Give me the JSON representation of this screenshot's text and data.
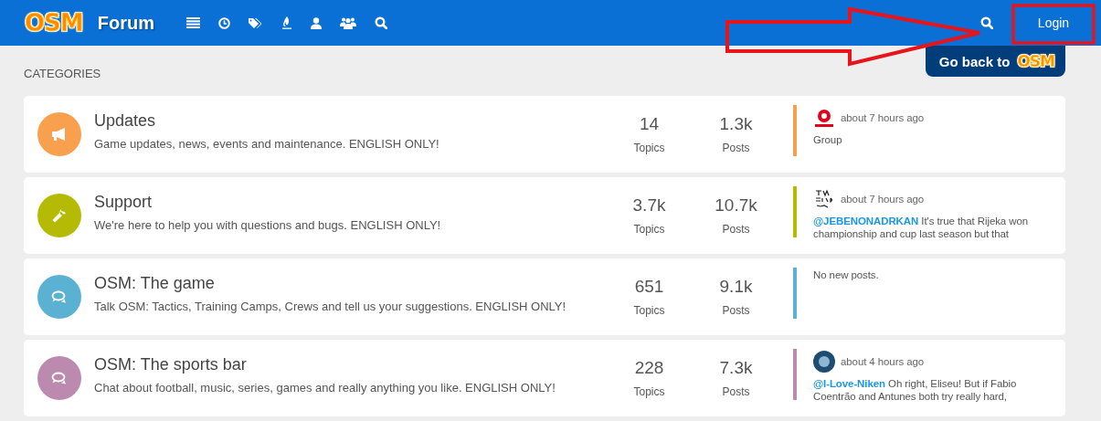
{
  "header": {
    "logo": "OSM",
    "title": "Forum",
    "nav_icons": [
      {
        "kind": "list"
      },
      {
        "kind": "clock"
      },
      {
        "kind": "tags"
      },
      {
        "kind": "flame"
      },
      {
        "kind": "user"
      },
      {
        "kind": "users"
      },
      {
        "kind": "search"
      }
    ],
    "login": "Login",
    "back_link": {
      "text": "Go back to",
      "logo": "OSM"
    }
  },
  "section_title": "CATEGORIES",
  "categories": [
    {
      "title": "Updates",
      "description": "Game updates, news, events and maintenance. ENGLISH ONLY!",
      "kind": "megaphone",
      "color": "#f9a04e",
      "topics": "14",
      "topics_label": "Topics",
      "posts": "1.3k",
      "posts_label": "Posts",
      "last_post": {
        "kind": "post",
        "time": "about 7 hours ago",
        "text": "Group"
      }
    },
    {
      "title": "Support",
      "description": "We're here to help you with questions and bugs. ENGLISH ONLY!",
      "kind": "wrench",
      "color": "#b5bb04",
      "topics": "3.7k",
      "topics_label": "Topics",
      "posts": "10.7k",
      "posts_label": "Posts",
      "last_post": {
        "kind": "post",
        "time": "about 7 hours ago",
        "user": "@JEBENONADRKAN",
        "text": "It's true that Rijeka won championship and cup last season but that"
      }
    },
    {
      "title": "OSM: The game",
      "description": "Talk OSM: Tactics, Training Camps, Crews and tell us your suggestions. ENGLISH ONLY!",
      "kind": "chat",
      "color": "#5bb1d1",
      "topics": "651",
      "topics_label": "Topics",
      "posts": "9.1k",
      "posts_label": "Posts",
      "last_post": {
        "kind": "empty",
        "text": "No new posts."
      }
    },
    {
      "title": "OSM: The sports bar",
      "description": "Chat about football, music, series, games and really anything you like. ENGLISH ONLY!",
      "kind": "chat",
      "color": "#bc8aae",
      "topics": "228",
      "topics_label": "Topics",
      "posts": "7.3k",
      "posts_label": "Posts",
      "last_post": {
        "kind": "post",
        "time": "about 4 hours ago",
        "user": "@I-Love-Niken",
        "text": "Oh right, Eliseu! But if Fabio Coentrão and Antunes both try really hard,"
      }
    }
  ]
}
